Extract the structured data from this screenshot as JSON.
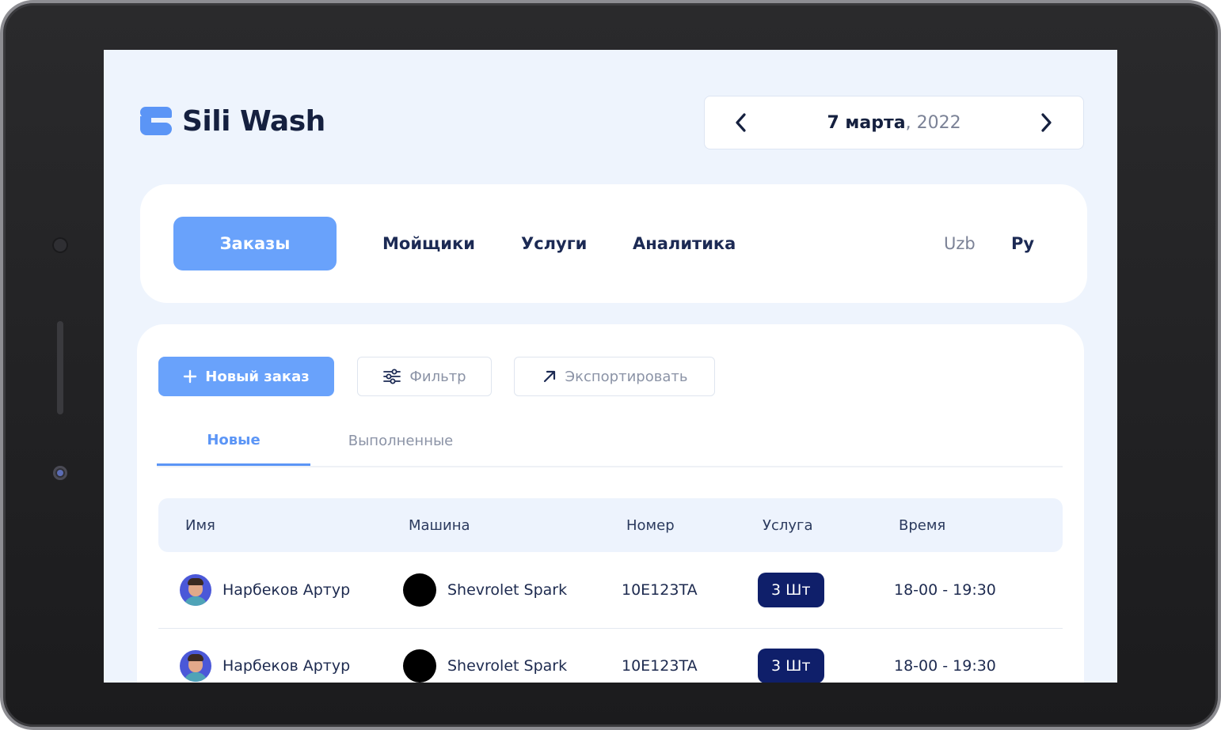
{
  "app": {
    "logo_text": "Sili Wash",
    "accent_color": "#69a2fb",
    "badge_color": "#0f1f6a"
  },
  "date": {
    "day_month": "7 марта",
    "separator": ",",
    "year": " 2022",
    "prev_icon": "chevron-left-icon",
    "next_icon": "chevron-right-icon"
  },
  "nav": {
    "items": [
      {
        "label": "Заказы",
        "active": true
      },
      {
        "label": "Мойщики"
      },
      {
        "label": "Услуги"
      },
      {
        "label": "Аналитика"
      }
    ],
    "languages": [
      {
        "label": "Uzb",
        "active": false
      },
      {
        "label": "Ру",
        "active": true
      }
    ]
  },
  "toolbar": {
    "new_order_label": "Новый заказ",
    "filter_label": "Фильтр",
    "export_label": "Экспортировать"
  },
  "tabs": [
    {
      "label": "Новые",
      "active": true
    },
    {
      "label": "Выполненные",
      "active": false
    }
  ],
  "table": {
    "headers": [
      "Имя",
      "Машина",
      "Номер",
      "Услуга",
      "Время"
    ],
    "rows": [
      {
        "name": "Нарбеков Артур",
        "car": "Shevrolet Spark",
        "number": "10E123TA",
        "service": "3 Шт",
        "time": "18-00 - 19:30"
      },
      {
        "name": "Нарбеков Артур",
        "car": "Shevrolet Spark",
        "number": "10E123TA",
        "service": "3 Шт",
        "time": "18-00 - 19:30"
      }
    ]
  }
}
